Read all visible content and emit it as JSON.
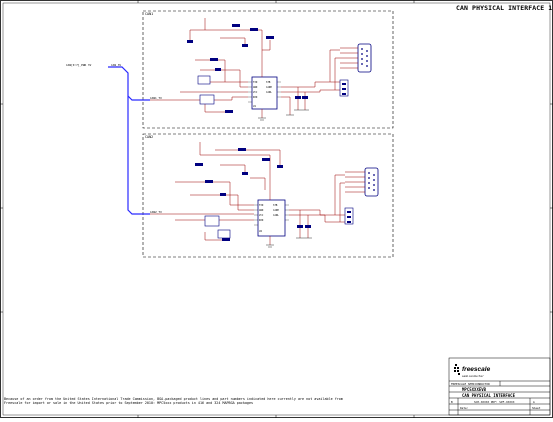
{
  "sheet": {
    "title": "CAN PHYSICAL INTERFACE 1",
    "column_markers": [
      "4",
      "3",
      "2",
      "1"
    ],
    "row_markers": [
      "D",
      "C",
      "B",
      "A"
    ]
  },
  "blocks": {
    "can1_label": "CAN1",
    "can2_label": "CAN2"
  },
  "nets": {
    "bus_label": "CAN[0:7]_PWR 3V",
    "bus_entry": "CAN_3V",
    "can1_tx": "CAN1_TX",
    "can2_tx": "CAN2_TX"
  },
  "footnote": "Because of an order from the United States International Trade Commission, BGA-packaged product lines and part numbers indicated here currently are not available from Freescale for import or sale in the United States prior to September 2010: MPC5xxx products in 416 and 324 MAPBGA packages",
  "title_block": {
    "logo_text": "freescale",
    "logo_sub": "semiconductor",
    "ref_label": "FREESCALE SEMICONDUCTOR",
    "board_name": "MPC5XXXEVB",
    "sheet_name": "CAN PHYSICAL INTERFACE",
    "doc_row": "SCH-XXXXX PDF: SPF-XXXXX",
    "size_label": "B",
    "rev_label": "A",
    "date_label": "Date:",
    "sheet_label": "Sheet"
  },
  "colors": {
    "wire": "#9b0000",
    "bus": "#2a2aff",
    "component": "#000080",
    "pin_text": "#000000",
    "border": "#000000"
  }
}
